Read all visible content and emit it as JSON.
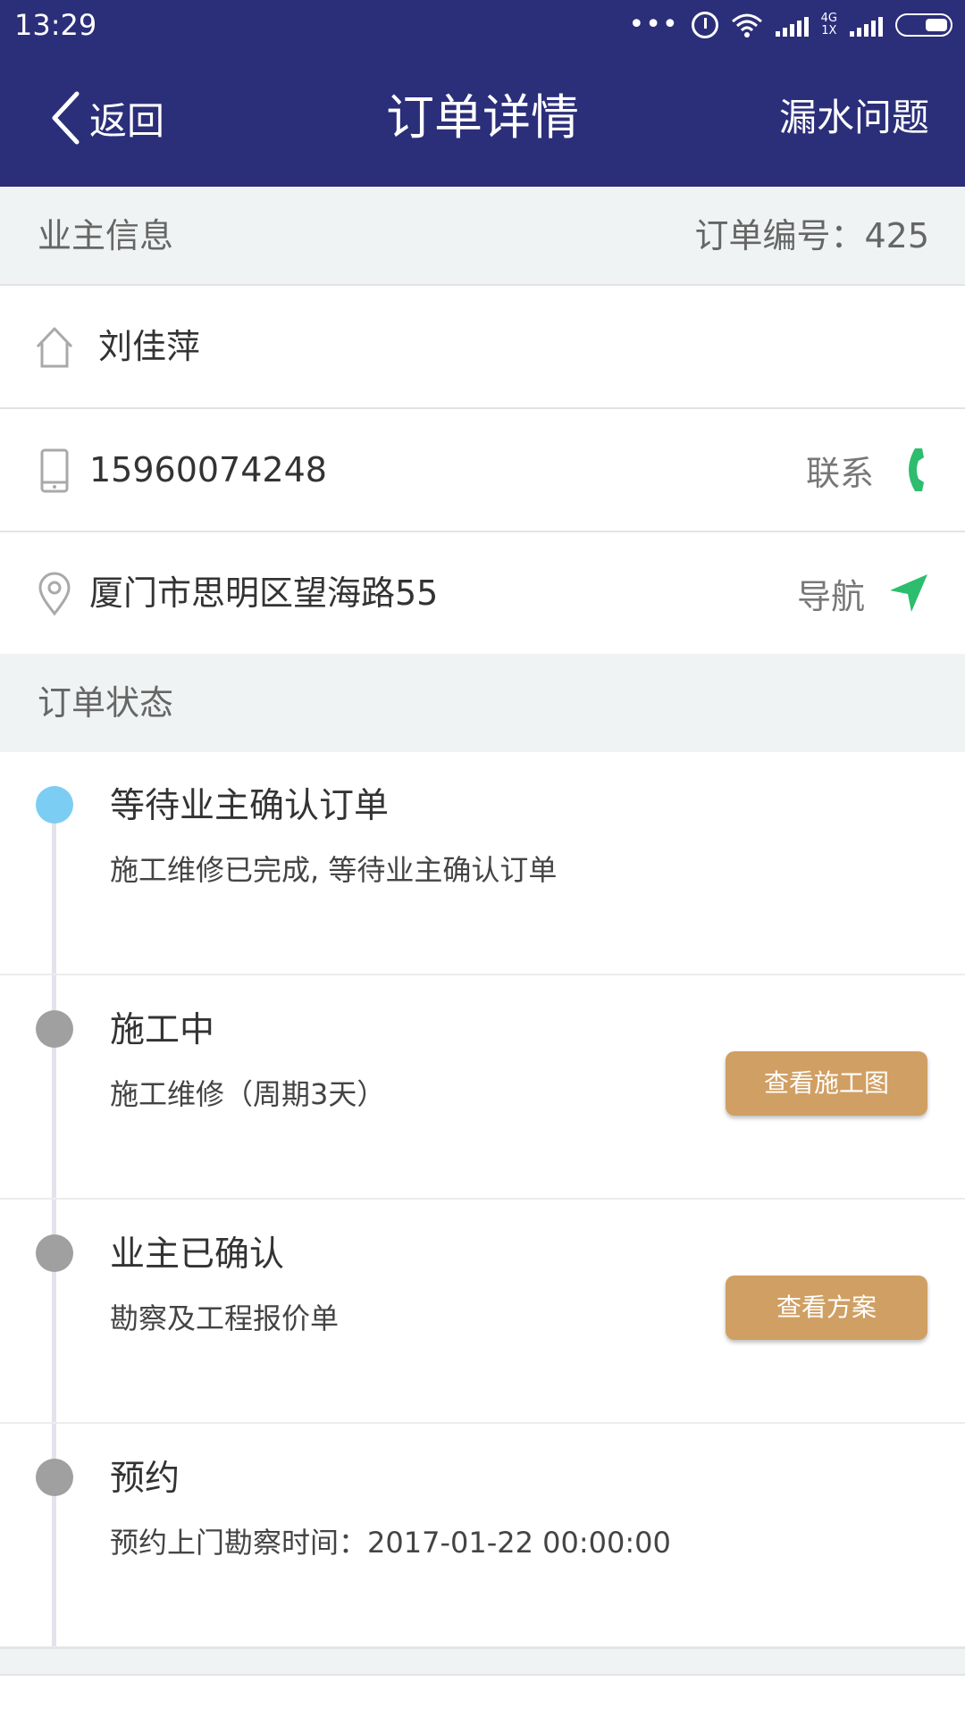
{
  "status_bar": {
    "time": "13:29",
    "dots": "•••",
    "network_label_top": "4G",
    "network_label_bottom": "1X"
  },
  "nav": {
    "back_label": "返回",
    "title": "订单详情",
    "action_label": "漏水问题"
  },
  "owner_section": {
    "title": "业主信息",
    "order_number": "订单编号：425"
  },
  "owner": {
    "name": "刘佳萍",
    "phone": "15960074248",
    "contact_label": "联系",
    "address": "厦门市思明区望海路55",
    "navigate_label": "导航"
  },
  "status_section": {
    "title": "订单状态"
  },
  "timeline": [
    {
      "title": "等待业主确认订单",
      "desc": "施工维修已完成, 等待业主确认订单",
      "active": true
    },
    {
      "title": "施工中",
      "desc": "施工维修（周期3天）",
      "button": "查看施工图"
    },
    {
      "title": "业主已确认",
      "desc": "勘察及工程报价单",
      "button": "查看方案"
    },
    {
      "title": "预约",
      "desc": "预约上门勘察时间：2017-01-22 00:00:00"
    }
  ],
  "colors": {
    "header_bg": "#2b2e79",
    "section_bg": "#f0f3f3",
    "accent_button": "#d09f63",
    "active_dot": "#7ccdf4",
    "inactive_dot": "#a0a0a0",
    "action_green": "#2dbd6e"
  },
  "icons": {
    "back": "chevron-left-icon",
    "name_row": "home-icon",
    "phone_row": "mobile-phone-icon",
    "phone_action": "phone-handset-icon",
    "address_row": "location-pin-icon",
    "navigate_action": "navigation-arrow-icon"
  }
}
